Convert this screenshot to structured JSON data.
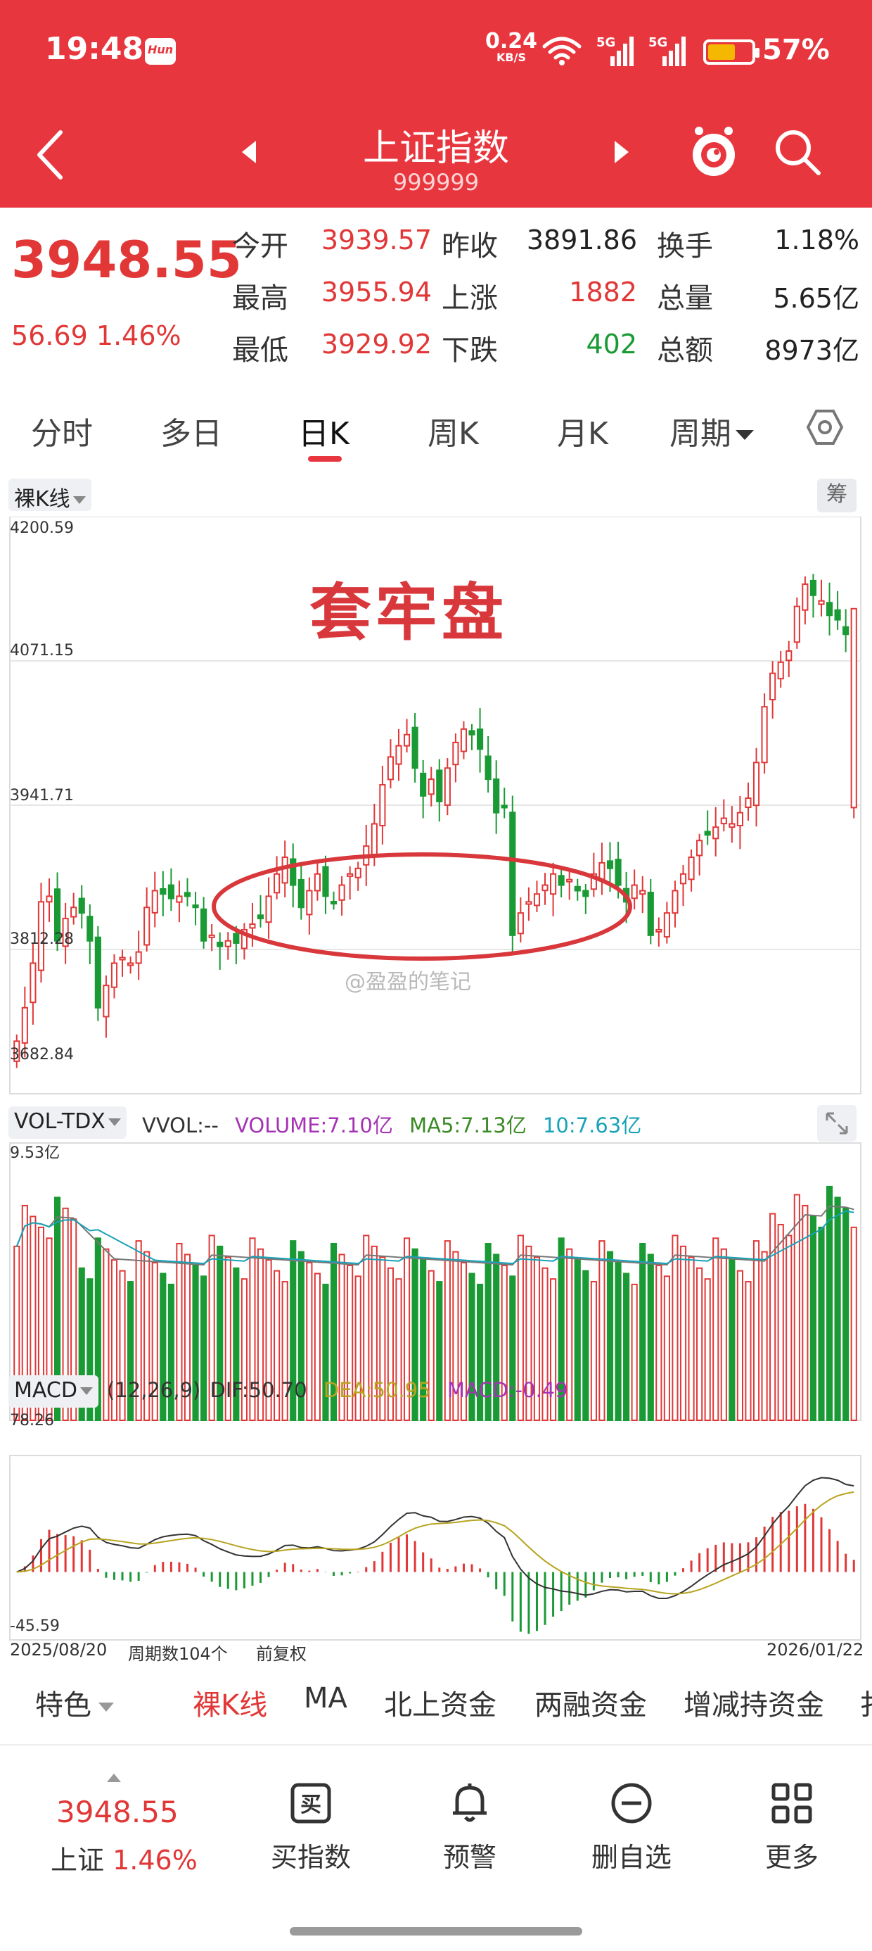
{
  "status_bar": {
    "time": "19:48",
    "app_badge": "Hun",
    "net_speed": "0.24",
    "net_unit": "KB/S",
    "sig1": "5G",
    "sig2": "5G",
    "battery": "57%",
    "battery_level": 0.57
  },
  "header": {
    "title": "上证指数",
    "code": "999999",
    "icons": [
      "back-icon",
      "prev-arrow-icon",
      "next-arrow-icon",
      "mascot-icon",
      "search-icon"
    ]
  },
  "quote": {
    "price": "3948.55",
    "change": "56.69",
    "change_pct": "1.46%",
    "rows": [
      [
        {
          "label": "今开",
          "value": "3939.57",
          "tone": "red"
        },
        {
          "label": "昨收",
          "value": "3891.86",
          "tone": "dark"
        },
        {
          "label": "换手",
          "value": "1.18%",
          "tone": "dark"
        }
      ],
      [
        {
          "label": "最高",
          "value": "3955.94",
          "tone": "red"
        },
        {
          "label": "上涨",
          "value": "1882",
          "tone": "red"
        },
        {
          "label": "总量",
          "value": "5.65亿",
          "tone": "dark"
        }
      ],
      [
        {
          "label": "最低",
          "value": "3929.92",
          "tone": "red"
        },
        {
          "label": "下跌",
          "value": "402",
          "tone": "green"
        },
        {
          "label": "总额",
          "value": "8973亿",
          "tone": "dark"
        }
      ]
    ]
  },
  "period_tabs": {
    "items": [
      "分时",
      "多日",
      "日K",
      "周K",
      "月K"
    ],
    "active": "日K",
    "more": "周期"
  },
  "kline": {
    "type_label": "裸K线",
    "chou_label": "筹",
    "annotation": "套牢盘",
    "watermark": "@盈盈的笔记",
    "y_ticks": [
      "4200.59",
      "4071.15",
      "3941.71",
      "3812.28",
      "3682.84"
    ]
  },
  "volume": {
    "name": "VOL-TDX",
    "vvol": "VVOL:--",
    "volume": "VOLUME:7.10亿",
    "ma5": "MA5:7.13亿",
    "ma10": "10:7.63亿",
    "max_label": "9.53亿"
  },
  "macd": {
    "name": "MACD",
    "params": "(12,26,9)",
    "dif": "DIF:50.70",
    "dea": "DEA:50.95",
    "macd": "MACD:-0.49",
    "max_label": "78.26",
    "min_label": "-45.59"
  },
  "chart_footer": {
    "start": "2025/08/20",
    "count": "周期数104个",
    "adjust": "前复权",
    "end": "2026/01/22"
  },
  "chart_data": {
    "type": "candlestick",
    "ylim": [
      3682.84,
      4200.59
    ],
    "last": {
      "open": 3939.57,
      "high": 3955.94,
      "low": 3929.92,
      "close": 3948.55
    },
    "volume_ylim": [
      0,
      9.53
    ],
    "macd_ylim": [
      -45.59,
      78.26
    ],
    "last_macd": {
      "dif": 50.7,
      "dea": 50.95,
      "macd": -0.49
    },
    "close": [
      3730,
      3760,
      3800,
      3855,
      3860,
      3820,
      3840,
      3850,
      3845,
      3820,
      3760,
      3780,
      3800,
      3805,
      3800,
      3810,
      3850,
      3865,
      3862,
      3858,
      3860,
      3860,
      3850,
      3820,
      3825,
      3815,
      3820,
      3818,
      3830,
      3835,
      3840,
      3860,
      3880,
      3895,
      3870,
      3850,
      3865,
      3880,
      3860,
      3855,
      3870,
      3880,
      3885,
      3905,
      3925,
      3960,
      3985,
      3995,
      4005,
      3975,
      3950,
      3965,
      3945,
      3975,
      3998,
      4010,
      4005,
      3992,
      3965,
      3935,
      3940,
      3825,
      3845,
      3855,
      3862,
      3870,
      3880,
      3870,
      3875,
      3865,
      3860,
      3880,
      3890,
      3885,
      3870,
      3855,
      3870,
      3865,
      3825,
      3830,
      3845,
      3865,
      3880,
      3895,
      3910,
      3915,
      3922,
      3930,
      3925,
      3935,
      3948,
      3980,
      4030,
      4060,
      4070,
      4080,
      4120,
      4140,
      4130,
      4125,
      4112,
      4108,
      4095,
      4118
    ]
  },
  "feature_tabs": {
    "items": [
      "特色",
      "裸K线",
      "MA",
      "北上资金",
      "两融资金",
      "增减持资金",
      "扌"
    ],
    "active": "裸K线"
  },
  "bottom_nav": {
    "price": "3948.55",
    "index_name": "上证",
    "index_pct": "1.46%",
    "items": [
      {
        "label": "买指数",
        "icon": "buy-icon"
      },
      {
        "label": "预警",
        "icon": "bell-icon"
      },
      {
        "label": "删自选",
        "icon": "remove-watchlist-icon"
      },
      {
        "label": "更多",
        "icon": "grid-icon"
      }
    ]
  },
  "colors": {
    "brand": "#e8363f",
    "up": "#e13737",
    "down": "#1a9a34",
    "ma5": "#777777",
    "ma10": "#17a2b8",
    "dif": "#333333",
    "dea": "#b8a41f",
    "annotation_ellipse": "#d8383c"
  }
}
